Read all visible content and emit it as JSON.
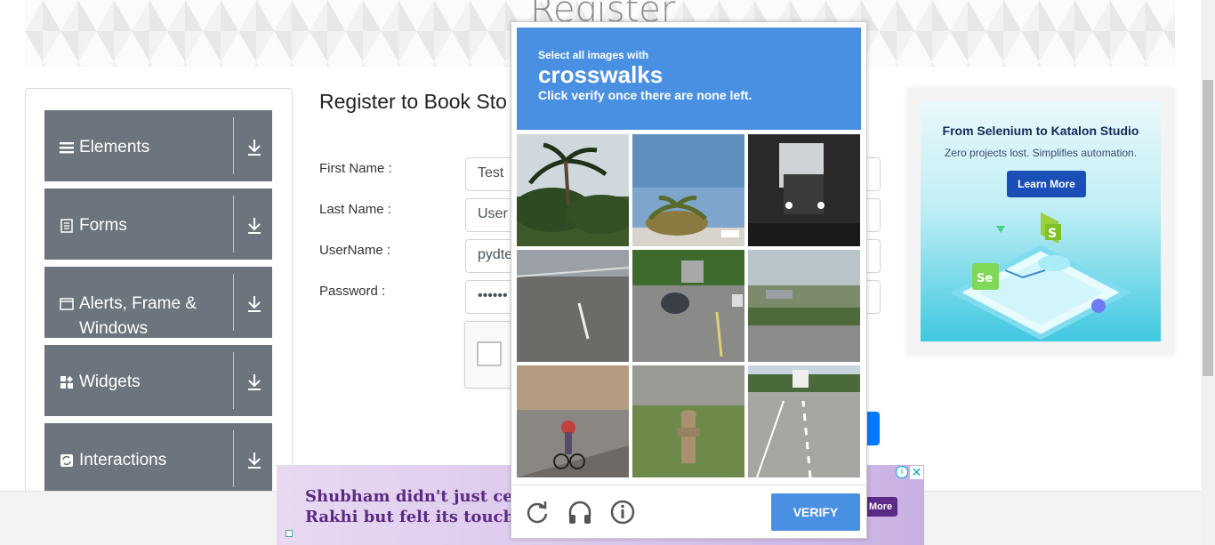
{
  "header": {
    "title": "Register"
  },
  "sidebar": {
    "groups": [
      {
        "label": "Elements",
        "icon": "list-icon"
      },
      {
        "label": "Forms",
        "icon": "document-icon"
      },
      {
        "label": "Alerts, Frame & Windows",
        "icon": "window-icon"
      },
      {
        "label": "Widgets",
        "icon": "widgets-icon"
      },
      {
        "label": "Interactions",
        "icon": "sync-icon"
      }
    ]
  },
  "form": {
    "title": "Register to Book Sto",
    "first_name_label": "First Name :",
    "first_name_value": "Test",
    "last_name_label": "Last Name :",
    "last_name_value": "User",
    "username_label": "UserName :",
    "username_value": "pydte",
    "password_label": "Password :",
    "password_value": "••••••"
  },
  "side_ad": {
    "title": "From Selenium to Katalon Studio",
    "subtitle": "Zero projects lost. Simplifies automation.",
    "button": "Learn More"
  },
  "bottom_ad": {
    "line1": "Shubham didn't just celebr",
    "line2": "Rakhi but felt its touch to",
    "button": "More",
    "info": "i",
    "close": "✕"
  },
  "captcha": {
    "prompt_small": "Select all images with",
    "target": "crosswalks",
    "instruction": "Click verify once there are none left.",
    "verify_label": "VERIFY",
    "tiles": [
      "palm-trees",
      "palm-tree-road",
      "tunnel-truck",
      "highway",
      "road-cars",
      "highway-overpass",
      "cyclist-sidewalk",
      "fire-hydrant",
      "highway-truck"
    ]
  },
  "colors": {
    "sidebar_group": "#6c757d",
    "captcha_blue": "#4a90e2",
    "primary": "#007bff"
  }
}
